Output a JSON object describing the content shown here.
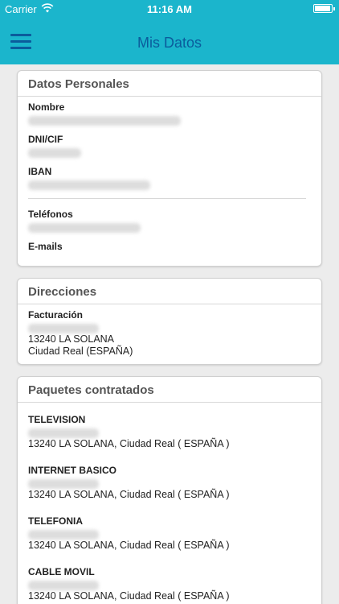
{
  "status_bar": {
    "carrier": "Carrier",
    "time": "11:16 AM",
    "battery_level": 0.95
  },
  "nav": {
    "title": "Mis Datos",
    "menu_icon": "hamburger-icon"
  },
  "personal": {
    "header": "Datos Personales",
    "fields": [
      {
        "label": "Nombre"
      },
      {
        "label": "DNI/CIF"
      },
      {
        "label": "IBAN"
      }
    ],
    "contact_fields": [
      {
        "label": "Teléfonos"
      },
      {
        "label": "E-mails"
      }
    ]
  },
  "addresses": {
    "header": "Direcciones",
    "label": "Facturación",
    "line2": "13240 LA SOLANA",
    "line3": "Ciudad Real (ESPAÑA)"
  },
  "packages": {
    "header": "Paquetes contratados",
    "items": [
      {
        "name": "TELEVISION",
        "location": "13240 LA SOLANA, Ciudad Real ( ESPAÑA )"
      },
      {
        "name": "INTERNET BASICO",
        "location": "13240 LA SOLANA, Ciudad Real ( ESPAÑA )"
      },
      {
        "name": "TELEFONIA",
        "location": "13240 LA SOLANA, Ciudad Real ( ESPAÑA )"
      },
      {
        "name": "CABLE MOVIL",
        "location": "13240 LA SOLANA, Ciudad Real ( ESPAÑA )"
      }
    ]
  },
  "colors": {
    "header_bg": "#1bb5cc",
    "title_color": "#0b5c9c",
    "page_bg": "#ececec"
  }
}
